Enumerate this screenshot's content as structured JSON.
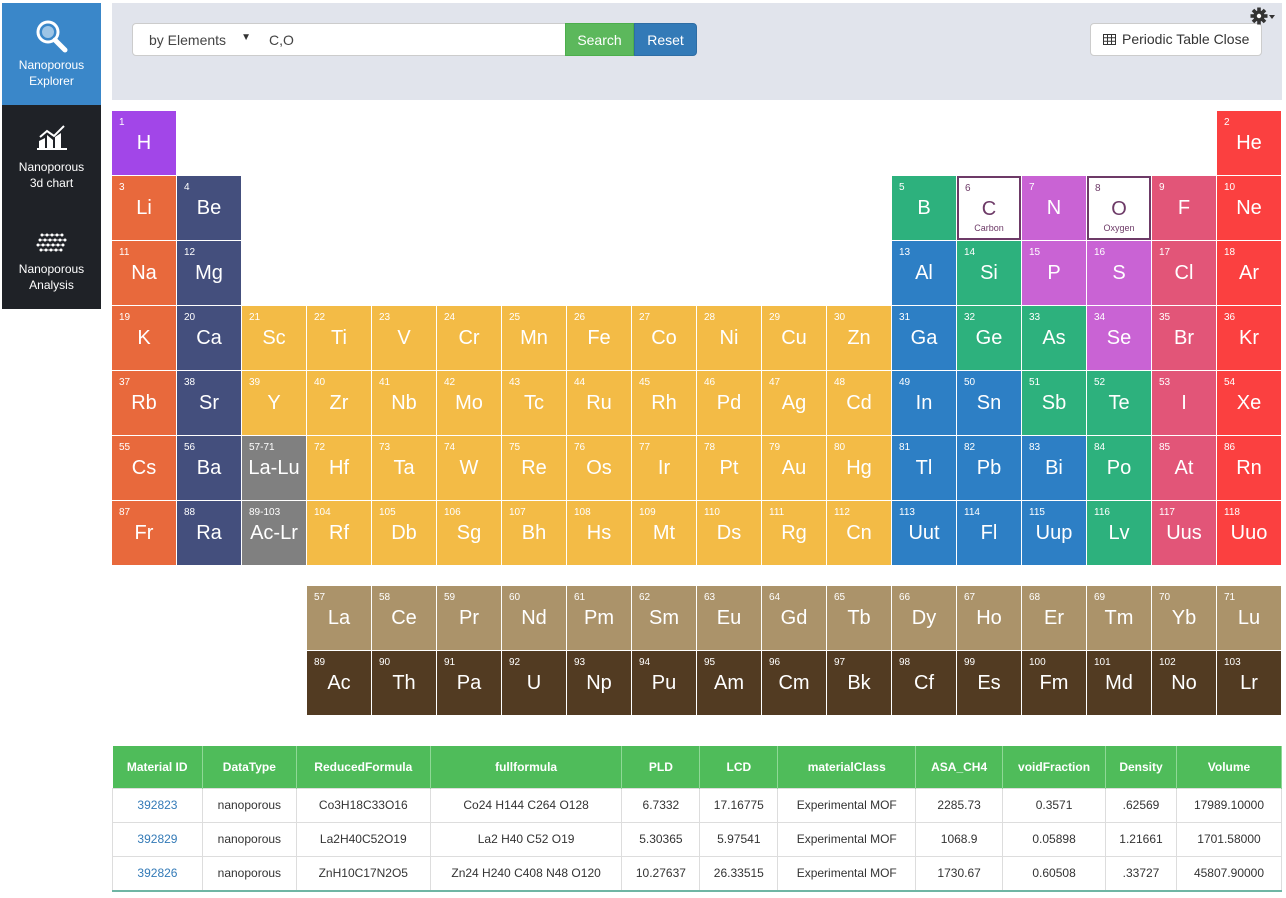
{
  "sidebar": {
    "items": [
      {
        "label_line1": "Nanoporous",
        "label_line2": "Explorer",
        "icon": "magnifier-icon",
        "active": true
      },
      {
        "label_line1": "Nanoporous",
        "label_line2": "3d chart",
        "icon": "chart-icon",
        "active": false
      },
      {
        "label_line1": "Nanoporous",
        "label_line2": "Analysis",
        "icon": "mesh-icon",
        "active": false
      }
    ]
  },
  "search": {
    "mode_selected": "by Elements",
    "query_value": "C,O",
    "search_label": "Search",
    "reset_label": "Reset",
    "periodic_toggle_label": "Periodic Table Close"
  },
  "colors": {
    "h": "#a246e8",
    "alkali": "#e8693c",
    "alkaline": "#444f7d",
    "transition": "#f3bb46",
    "posttransition": "#2d7fc5",
    "metalloid": "#2db17d",
    "nonmetal": "#c963d4",
    "halogen": "#e25578",
    "noble": "#fb4040",
    "lnac_ref": "#808080",
    "lanthanide": "#ab936a",
    "actinide": "#523b22",
    "selected_border": "#6d3a67"
  },
  "periodic_table": {
    "elements": [
      {
        "n": "1",
        "s": "H",
        "c": "h"
      },
      {
        "n": "2",
        "s": "He",
        "c": "noble"
      },
      {
        "n": "3",
        "s": "Li",
        "c": "alkali"
      },
      {
        "n": "4",
        "s": "Be",
        "c": "alkaline"
      },
      {
        "n": "5",
        "s": "B",
        "c": "metalloid"
      },
      {
        "n": "6",
        "s": "C",
        "c": "nonmetal",
        "sel": true,
        "name": "Carbon"
      },
      {
        "n": "7",
        "s": "N",
        "c": "nonmetal"
      },
      {
        "n": "8",
        "s": "O",
        "c": "nonmetal",
        "sel": true,
        "name": "Oxygen"
      },
      {
        "n": "9",
        "s": "F",
        "c": "halogen"
      },
      {
        "n": "10",
        "s": "Ne",
        "c": "noble"
      },
      {
        "n": "11",
        "s": "Na",
        "c": "alkali"
      },
      {
        "n": "12",
        "s": "Mg",
        "c": "alkaline"
      },
      {
        "n": "13",
        "s": "Al",
        "c": "posttransition"
      },
      {
        "n": "14",
        "s": "Si",
        "c": "metalloid"
      },
      {
        "n": "15",
        "s": "P",
        "c": "nonmetal"
      },
      {
        "n": "16",
        "s": "S",
        "c": "nonmetal"
      },
      {
        "n": "17",
        "s": "Cl",
        "c": "halogen"
      },
      {
        "n": "18",
        "s": "Ar",
        "c": "noble"
      },
      {
        "n": "19",
        "s": "K",
        "c": "alkali"
      },
      {
        "n": "20",
        "s": "Ca",
        "c": "alkaline"
      },
      {
        "n": "21",
        "s": "Sc",
        "c": "transition"
      },
      {
        "n": "22",
        "s": "Ti",
        "c": "transition"
      },
      {
        "n": "23",
        "s": "V",
        "c": "transition"
      },
      {
        "n": "24",
        "s": "Cr",
        "c": "transition"
      },
      {
        "n": "25",
        "s": "Mn",
        "c": "transition"
      },
      {
        "n": "26",
        "s": "Fe",
        "c": "transition"
      },
      {
        "n": "27",
        "s": "Co",
        "c": "transition"
      },
      {
        "n": "28",
        "s": "Ni",
        "c": "transition"
      },
      {
        "n": "29",
        "s": "Cu",
        "c": "transition"
      },
      {
        "n": "30",
        "s": "Zn",
        "c": "transition"
      },
      {
        "n": "31",
        "s": "Ga",
        "c": "posttransition"
      },
      {
        "n": "32",
        "s": "Ge",
        "c": "metalloid"
      },
      {
        "n": "33",
        "s": "As",
        "c": "metalloid"
      },
      {
        "n": "34",
        "s": "Se",
        "c": "nonmetal"
      },
      {
        "n": "35",
        "s": "Br",
        "c": "halogen"
      },
      {
        "n": "36",
        "s": "Kr",
        "c": "noble"
      },
      {
        "n": "37",
        "s": "Rb",
        "c": "alkali"
      },
      {
        "n": "38",
        "s": "Sr",
        "c": "alkaline"
      },
      {
        "n": "39",
        "s": "Y",
        "c": "transition"
      },
      {
        "n": "40",
        "s": "Zr",
        "c": "transition"
      },
      {
        "n": "41",
        "s": "Nb",
        "c": "transition"
      },
      {
        "n": "42",
        "s": "Mo",
        "c": "transition"
      },
      {
        "n": "43",
        "s": "Tc",
        "c": "transition"
      },
      {
        "n": "44",
        "s": "Ru",
        "c": "transition"
      },
      {
        "n": "45",
        "s": "Rh",
        "c": "transition"
      },
      {
        "n": "46",
        "s": "Pd",
        "c": "transition"
      },
      {
        "n": "47",
        "s": "Ag",
        "c": "transition"
      },
      {
        "n": "48",
        "s": "Cd",
        "c": "transition"
      },
      {
        "n": "49",
        "s": "In",
        "c": "posttransition"
      },
      {
        "n": "50",
        "s": "Sn",
        "c": "posttransition"
      },
      {
        "n": "51",
        "s": "Sb",
        "c": "metalloid"
      },
      {
        "n": "52",
        "s": "Te",
        "c": "metalloid"
      },
      {
        "n": "53",
        "s": "I",
        "c": "halogen"
      },
      {
        "n": "54",
        "s": "Xe",
        "c": "noble"
      },
      {
        "n": "55",
        "s": "Cs",
        "c": "alkali"
      },
      {
        "n": "56",
        "s": "Ba",
        "c": "alkaline"
      },
      {
        "n": "57-71",
        "s": "La-Lu",
        "c": "lnac_ref"
      },
      {
        "n": "72",
        "s": "Hf",
        "c": "transition"
      },
      {
        "n": "73",
        "s": "Ta",
        "c": "transition"
      },
      {
        "n": "74",
        "s": "W",
        "c": "transition"
      },
      {
        "n": "75",
        "s": "Re",
        "c": "transition"
      },
      {
        "n": "76",
        "s": "Os",
        "c": "transition"
      },
      {
        "n": "77",
        "s": "Ir",
        "c": "transition"
      },
      {
        "n": "78",
        "s": "Pt",
        "c": "transition"
      },
      {
        "n": "79",
        "s": "Au",
        "c": "transition"
      },
      {
        "n": "80",
        "s": "Hg",
        "c": "transition"
      },
      {
        "n": "81",
        "s": "Tl",
        "c": "posttransition"
      },
      {
        "n": "82",
        "s": "Pb",
        "c": "posttransition"
      },
      {
        "n": "83",
        "s": "Bi",
        "c": "posttransition"
      },
      {
        "n": "84",
        "s": "Po",
        "c": "metalloid"
      },
      {
        "n": "85",
        "s": "At",
        "c": "halogen"
      },
      {
        "n": "86",
        "s": "Rn",
        "c": "noble"
      },
      {
        "n": "87",
        "s": "Fr",
        "c": "alkali"
      },
      {
        "n": "88",
        "s": "Ra",
        "c": "alkaline"
      },
      {
        "n": "89-103",
        "s": "Ac-Lr",
        "c": "lnac_ref"
      },
      {
        "n": "104",
        "s": "Rf",
        "c": "transition"
      },
      {
        "n": "105",
        "s": "Db",
        "c": "transition"
      },
      {
        "n": "106",
        "s": "Sg",
        "c": "transition"
      },
      {
        "n": "107",
        "s": "Bh",
        "c": "transition"
      },
      {
        "n": "108",
        "s": "Hs",
        "c": "transition"
      },
      {
        "n": "109",
        "s": "Mt",
        "c": "transition"
      },
      {
        "n": "110",
        "s": "Ds",
        "c": "transition"
      },
      {
        "n": "111",
        "s": "Rg",
        "c": "transition"
      },
      {
        "n": "112",
        "s": "Cn",
        "c": "transition"
      },
      {
        "n": "113",
        "s": "Uut",
        "c": "posttransition"
      },
      {
        "n": "114",
        "s": "Fl",
        "c": "posttransition"
      },
      {
        "n": "115",
        "s": "Uup",
        "c": "posttransition"
      },
      {
        "n": "116",
        "s": "Lv",
        "c": "metalloid"
      },
      {
        "n": "117",
        "s": "Uus",
        "c": "halogen"
      },
      {
        "n": "118",
        "s": "Uuo",
        "c": "noble"
      },
      {
        "n": "57",
        "s": "La",
        "c": "lanthanide"
      },
      {
        "n": "58",
        "s": "Ce",
        "c": "lanthanide"
      },
      {
        "n": "59",
        "s": "Pr",
        "c": "lanthanide"
      },
      {
        "n": "60",
        "s": "Nd",
        "c": "lanthanide"
      },
      {
        "n": "61",
        "s": "Pm",
        "c": "lanthanide"
      },
      {
        "n": "62",
        "s": "Sm",
        "c": "lanthanide"
      },
      {
        "n": "63",
        "s": "Eu",
        "c": "lanthanide"
      },
      {
        "n": "64",
        "s": "Gd",
        "c": "lanthanide"
      },
      {
        "n": "65",
        "s": "Tb",
        "c": "lanthanide"
      },
      {
        "n": "66",
        "s": "Dy",
        "c": "lanthanide"
      },
      {
        "n": "67",
        "s": "Ho",
        "c": "lanthanide"
      },
      {
        "n": "68",
        "s": "Er",
        "c": "lanthanide"
      },
      {
        "n": "69",
        "s": "Tm",
        "c": "lanthanide"
      },
      {
        "n": "70",
        "s": "Yb",
        "c": "lanthanide"
      },
      {
        "n": "71",
        "s": "Lu",
        "c": "lanthanide"
      },
      {
        "n": "89",
        "s": "Ac",
        "c": "actinide"
      },
      {
        "n": "90",
        "s": "Th",
        "c": "actinide"
      },
      {
        "n": "91",
        "s": "Pa",
        "c": "actinide"
      },
      {
        "n": "92",
        "s": "U",
        "c": "actinide"
      },
      {
        "n": "93",
        "s": "Np",
        "c": "actinide"
      },
      {
        "n": "94",
        "s": "Pu",
        "c": "actinide"
      },
      {
        "n": "95",
        "s": "Am",
        "c": "actinide"
      },
      {
        "n": "96",
        "s": "Cm",
        "c": "actinide"
      },
      {
        "n": "97",
        "s": "Bk",
        "c": "actinide"
      },
      {
        "n": "98",
        "s": "Cf",
        "c": "actinide"
      },
      {
        "n": "99",
        "s": "Es",
        "c": "actinide"
      },
      {
        "n": "100",
        "s": "Fm",
        "c": "actinide"
      },
      {
        "n": "101",
        "s": "Md",
        "c": "actinide"
      },
      {
        "n": "102",
        "s": "No",
        "c": "actinide"
      },
      {
        "n": "103",
        "s": "Lr",
        "c": "actinide"
      }
    ]
  },
  "results": {
    "headers": [
      "Material ID",
      "DataType",
      "ReducedFormula",
      "fullformula",
      "PLD",
      "LCD",
      "materialClass",
      "ASA_CH4",
      "voidFraction",
      "Density",
      "Volume"
    ],
    "rows": [
      [
        "392823",
        "nanoporous",
        "Co3H18C33O16",
        "Co24 H144 C264 O128",
        "6.7332",
        "17.16775",
        "Experimental MOF",
        "2285.73",
        "0.3571",
        ".62569",
        "17989.10000"
      ],
      [
        "392829",
        "nanoporous",
        "La2H40C52O19",
        "La2 H40 C52 O19",
        "5.30365",
        "5.97541",
        "Experimental MOF",
        "1068.9",
        "0.05898",
        "1.21661",
        "1701.58000"
      ],
      [
        "392826",
        "nanoporous",
        "ZnH10C17N2O5",
        "Zn24 H240 C408 N48 O120",
        "10.27637",
        "26.33515",
        "Experimental MOF",
        "1730.67",
        "0.60508",
        ".33727",
        "45807.90000"
      ]
    ]
  }
}
